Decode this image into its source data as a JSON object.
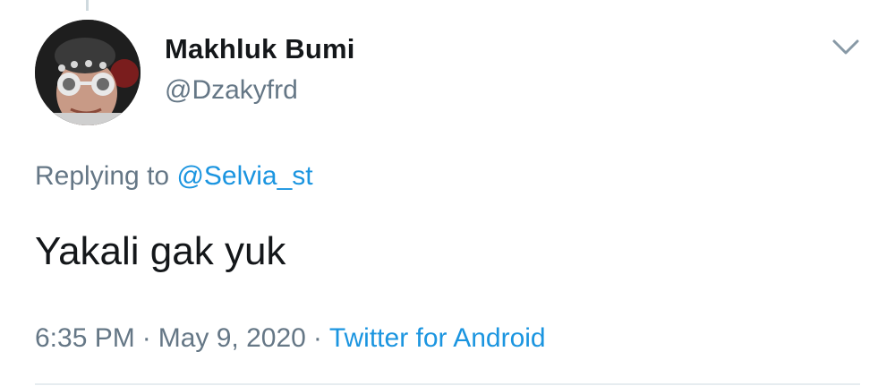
{
  "tweet": {
    "author": {
      "display_name": "Makhluk Bumi",
      "handle": "@Dzakyfrd"
    },
    "replying_to": {
      "prefix": "Replying to",
      "handle": "@Selvia_st"
    },
    "text": "Yakali gak yuk",
    "meta": {
      "time": "6:35 PM",
      "date": "May 9, 2020",
      "separator": "·",
      "source": "Twitter for Android"
    }
  },
  "icons": {
    "menu": "chevron-down-icon",
    "avatar": "avatar"
  },
  "colors": {
    "text_primary": "#14171a",
    "text_secondary": "#657786",
    "link": "#1b95e0",
    "divider": "#e6ecf0"
  }
}
